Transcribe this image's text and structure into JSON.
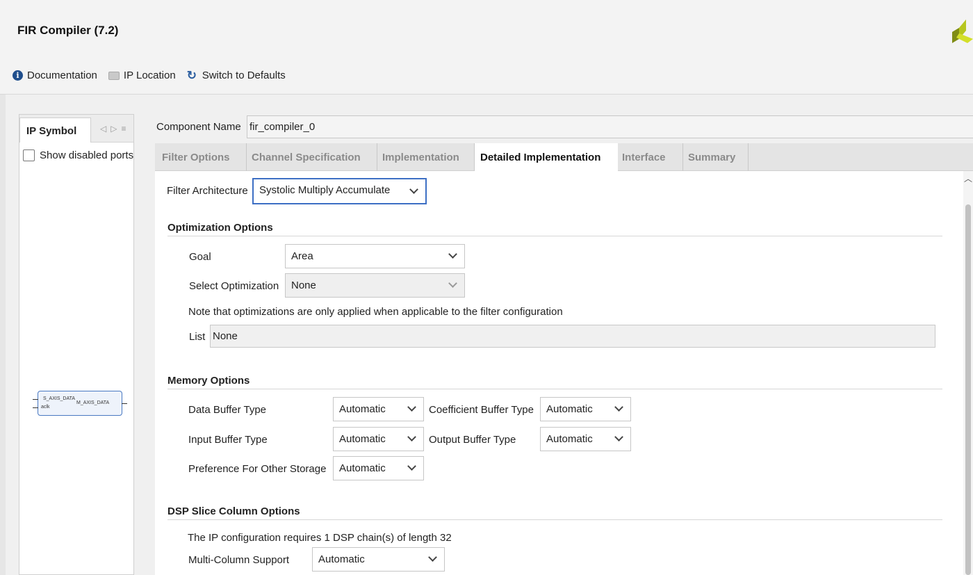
{
  "window": {
    "title": "FIR Compiler (7.2)"
  },
  "toolbar": {
    "documentation": "Documentation",
    "ip_location": "IP Location",
    "switch_defaults": "Switch to Defaults"
  },
  "ip_panel": {
    "tab_label": "IP Symbol",
    "show_disabled_ports": "Show disabled ports",
    "symbol": {
      "s_axis": "S_AXIS_DATA",
      "aclk": "aclk",
      "m_axis": "M_AXIS_DATA"
    }
  },
  "component": {
    "label": "Component Name",
    "value": "fir_compiler_0"
  },
  "tabs": [
    {
      "label": "Filter Options"
    },
    {
      "label": "Channel Specification"
    },
    {
      "label": "Implementation"
    },
    {
      "label": "Detailed Implementation"
    },
    {
      "label": "Interface"
    },
    {
      "label": "Summary"
    }
  ],
  "active_tab": "Detailed Implementation",
  "filter_architecture": {
    "label": "Filter Architecture",
    "value": "Systolic Multiply Accumulate"
  },
  "optimization": {
    "title": "Optimization Options",
    "goal_label": "Goal",
    "goal_value": "Area",
    "select_label": "Select Optimization",
    "select_value": "None",
    "note": "Note that optimizations are only applied when applicable to the filter configuration",
    "list_label": "List",
    "list_value": "None"
  },
  "memory": {
    "title": "Memory Options",
    "data_buffer_label": "Data Buffer Type",
    "data_buffer_value": "Automatic",
    "coef_buffer_label": "Coefficient Buffer Type",
    "coef_buffer_value": "Automatic",
    "input_buffer_label": "Input Buffer Type",
    "input_buffer_value": "Automatic",
    "output_buffer_label": "Output Buffer Type",
    "output_buffer_value": "Automatic",
    "pref_label": "Preference For Other Storage",
    "pref_value": "Automatic"
  },
  "dsp": {
    "title": "DSP Slice Column Options",
    "info": "The IP configuration requires 1 DSP chain(s) of length 32",
    "multi_label": "Multi-Column Support",
    "multi_value": "Automatic"
  },
  "colors": {
    "accent": "#3d6fc4",
    "logo": "#a8b81e",
    "info_icon": "#1f4e8c"
  },
  "icons": [
    "info-icon",
    "folder-icon",
    "refresh-icon",
    "chevron-down-icon",
    "xilinx-logo"
  ]
}
